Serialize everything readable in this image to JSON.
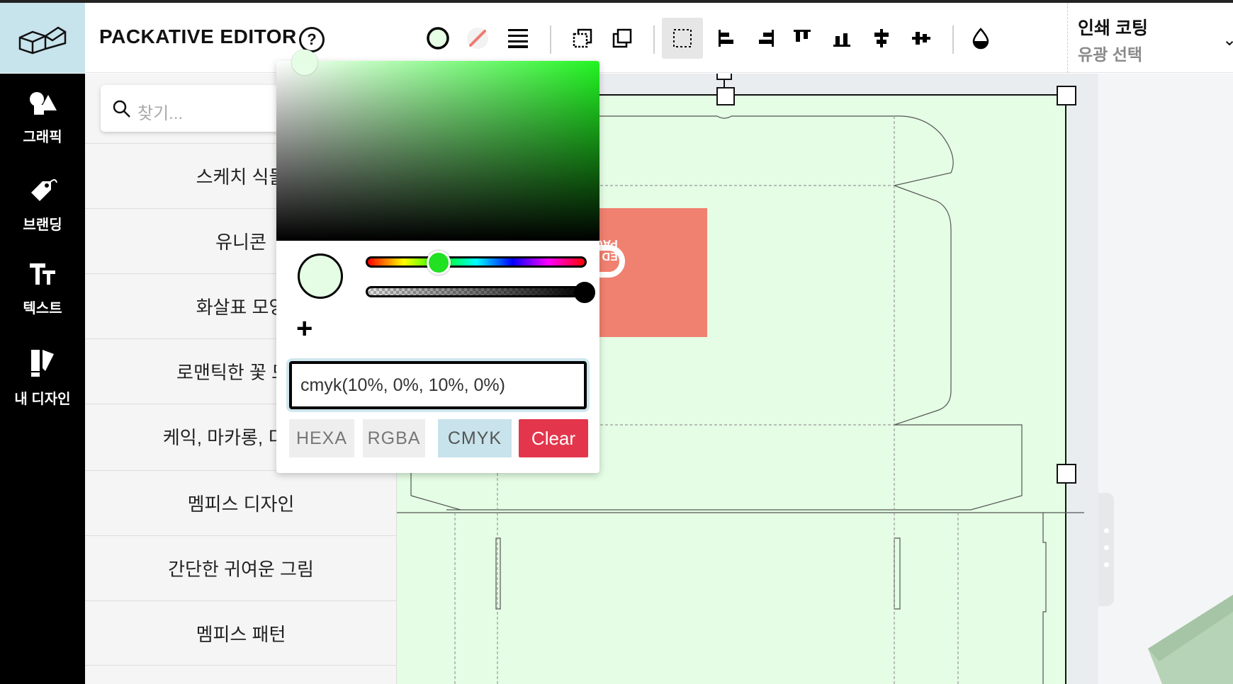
{
  "app": {
    "brand": "PACKATIVE EDITOR",
    "help_symbol": "?"
  },
  "print_panel": {
    "title": "인쇄 코팅",
    "subtitle": "유광 선택"
  },
  "sidebar": {
    "items": [
      {
        "label": "그래픽",
        "icon": "shapes-icon"
      },
      {
        "label": "브랜딩",
        "icon": "tag-icon"
      },
      {
        "label": "텍스트",
        "icon": "text-icon"
      },
      {
        "label": "내 디자인",
        "icon": "my-design-icon"
      }
    ]
  },
  "category_panel": {
    "search_placeholder": "찾기...",
    "categories": [
      "스케치 식물",
      "유니콘",
      "화살표 모양",
      "로맨틱한 꽃 모양",
      "케익, 마카롱, 디저트",
      "멤피스 디자인",
      "간단한 귀여운 그림",
      "멤피스 패턴"
    ]
  },
  "color_picker": {
    "input_value": "cmyk(10%, 0%, 10%, 0%)",
    "current_color": "#e4fde4",
    "add_symbol": "+",
    "formats": [
      "HEXA",
      "RGBA",
      "CMYK"
    ],
    "active_format": "CMYK",
    "clear_label": "Clear"
  },
  "canvas": {
    "label_text": "PACKA",
    "label_text_2": "ED",
    "box_fill": "#e4fde4",
    "label_color": "#f08070"
  },
  "colors": {
    "accent_red": "#e3354b",
    "accent_blue": "#c8e3eb",
    "logo_bg": "#c7e3ec"
  }
}
